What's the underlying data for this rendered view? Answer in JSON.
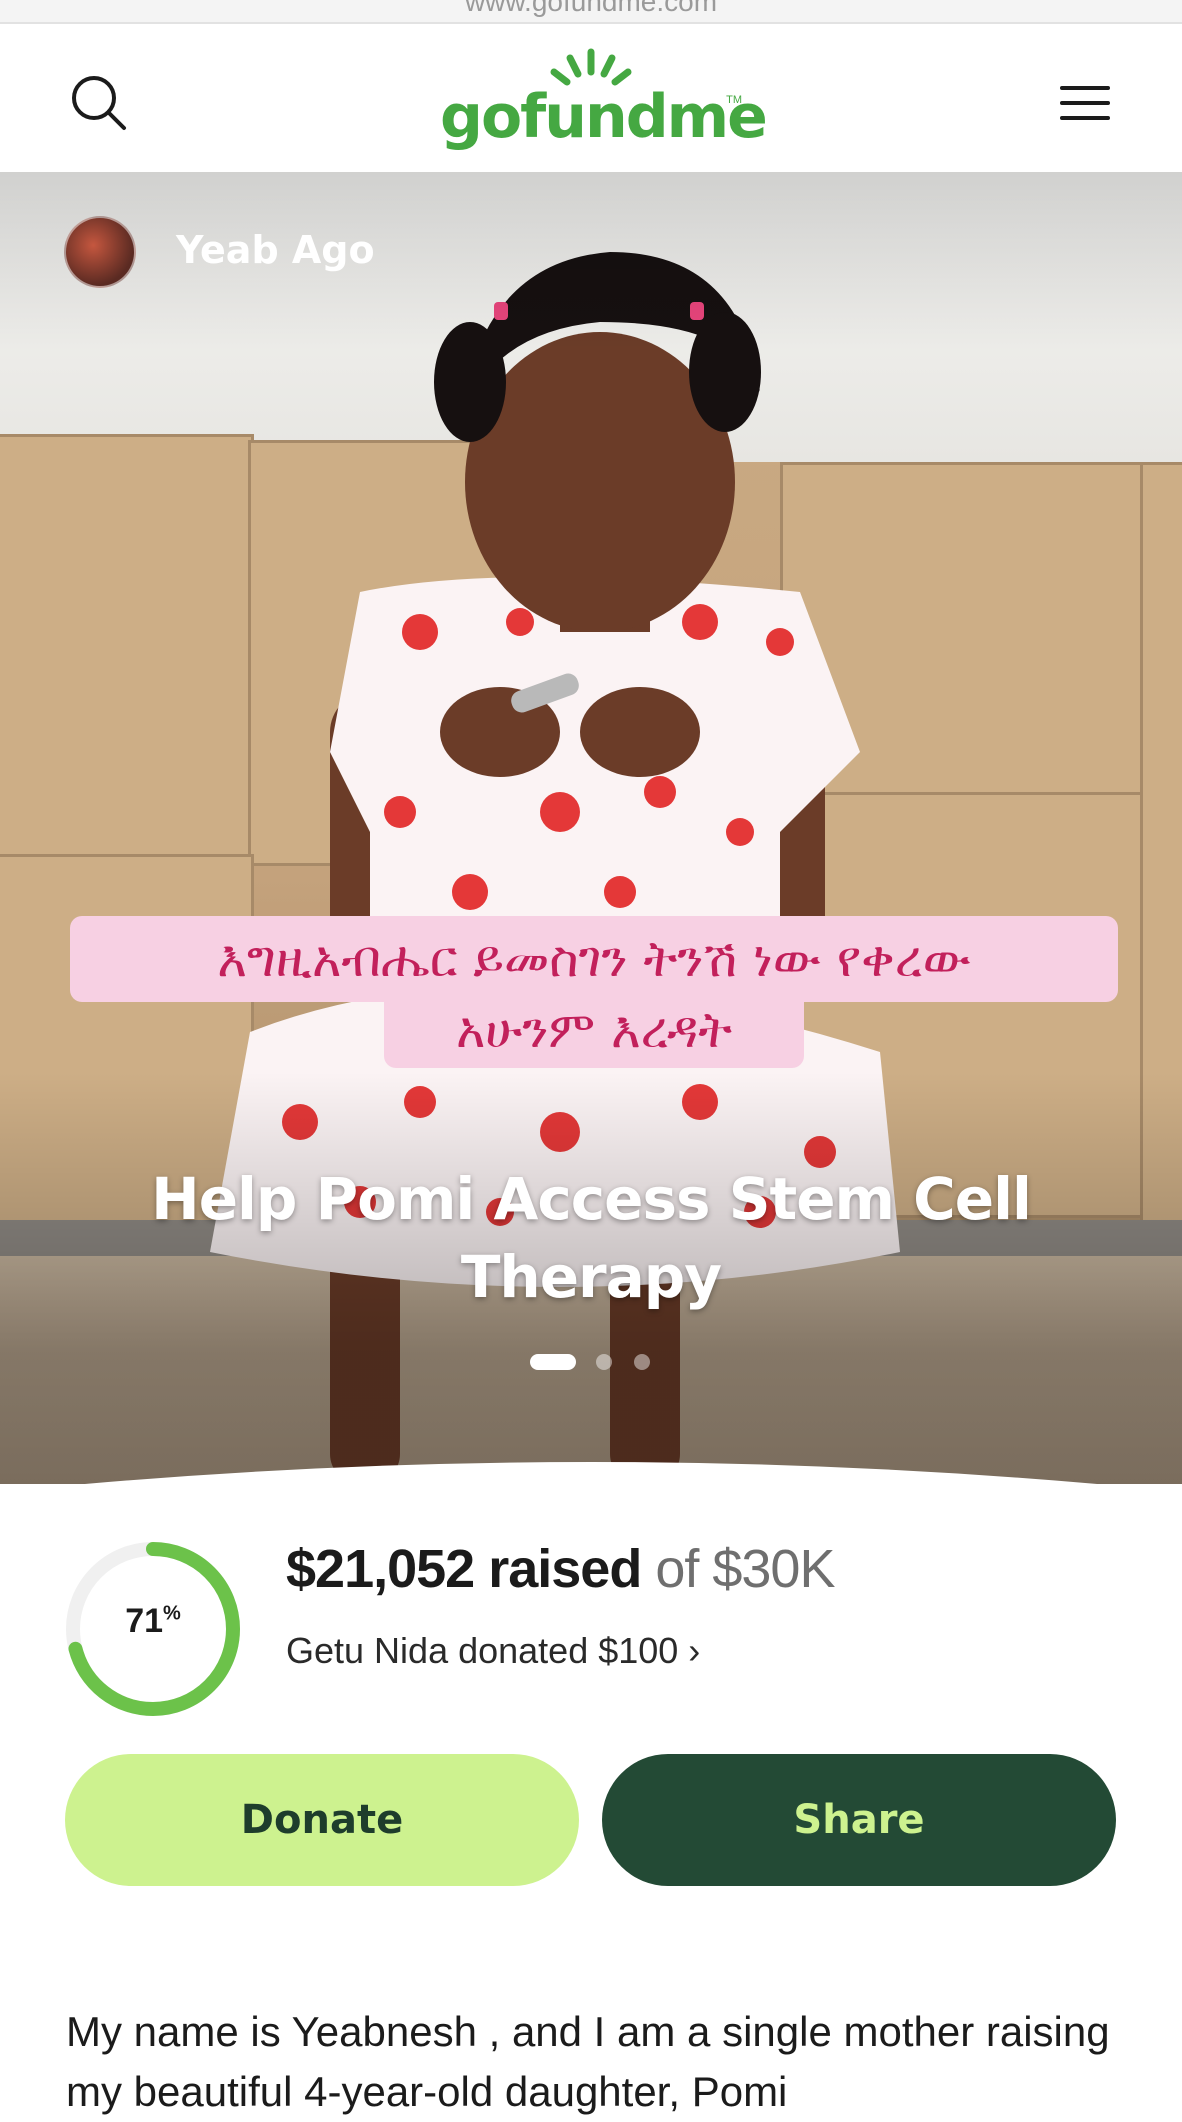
{
  "url_bar": {
    "text": "www.gofundme.com"
  },
  "header": {
    "logo_text": "gofundme",
    "logo_tm": "TM"
  },
  "hero": {
    "author_name": "Yeab Ago",
    "overlay_line_1": "እግዚአብሔር ይመስገን ትንሽ ነው የቀረው",
    "overlay_line_2": "አሁንም እረዳት",
    "title": "Help Pomi Access Stem Cell Therapy",
    "carousel": {
      "slides": 3,
      "active": 1
    }
  },
  "progress": {
    "percent": 71,
    "percent_label": "71",
    "percent_symbol": "%",
    "raised_amount": "$21,052 raised",
    "goal": "of $30K",
    "recent_donation": "Getu Nida donated $100 ›"
  },
  "actions": {
    "donate_label": "Donate",
    "share_label": "Share"
  },
  "story": {
    "text": "My name is Yeabnesh , and I am a single mother raising my beautiful 4-year-old daughter, Pomi"
  },
  "colors": {
    "brand_green": "#45a842",
    "donate_bg": "#cdf28f",
    "share_bg": "#234a35",
    "progress_fill": "#6cc24a",
    "overlay_pink": "#f7d0e3",
    "overlay_text": "#c2205b"
  },
  "icons": {
    "search": "search-icon",
    "menu": "hamburger-menu-icon"
  }
}
